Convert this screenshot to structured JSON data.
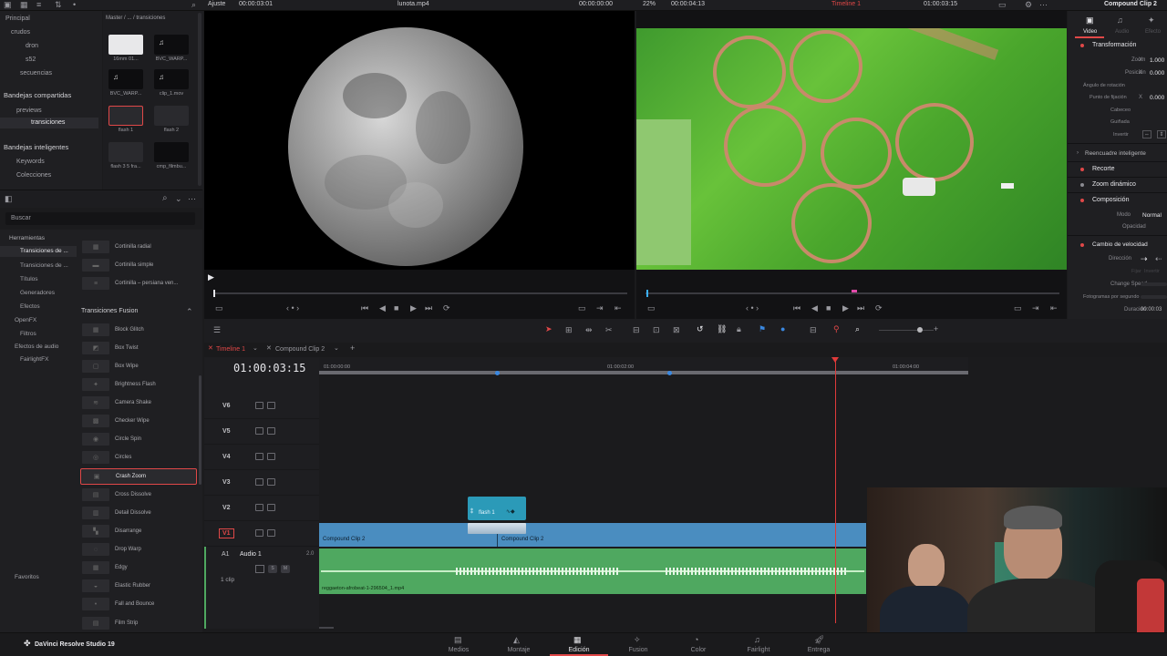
{
  "top_bar": {
    "zoom_label": "Ajuste",
    "left_timecode": "00:00:03:01",
    "left_clip_name": "lunota.mp4",
    "left_duration": "00:00:00:00",
    "right_zoom": "22%",
    "right_duration": "00:00:04:13",
    "timeline_name": "Timeline 1",
    "right_timecode": "01:00:03:15",
    "inspector_title": "Compound Clip 2"
  },
  "media_pool": {
    "breadcrumb": "Master / ... / transiciones",
    "tree": [
      {
        "label": "Principal"
      },
      {
        "label": "crudos"
      },
      {
        "label": "dron"
      },
      {
        "label": "s52"
      },
      {
        "label": "secuencias"
      }
    ],
    "shared_header": "Bandejas compartidas",
    "shared_items": [
      {
        "label": "previews"
      },
      {
        "label": "transiciones"
      }
    ],
    "smart_header": "Bandejas inteligentes",
    "smart_items": [
      {
        "label": "Keywords"
      },
      {
        "label": "Colecciones"
      }
    ],
    "clips": [
      {
        "label": "16mm 01..."
      },
      {
        "label": "BVC_WARP..."
      },
      {
        "label": "BVC_WARP..."
      },
      {
        "label": "clip_1.mov"
      },
      {
        "label": "flash 1"
      },
      {
        "label": "flash 2"
      },
      {
        "label": "flash 3 5 fra..."
      },
      {
        "label": "cmp_filmbu..."
      }
    ]
  },
  "effects": {
    "search_label": "Buscar",
    "tree": [
      {
        "label": "Herramientas"
      },
      {
        "label": "Transiciones de ..."
      },
      {
        "label": "Transiciones de ..."
      },
      {
        "label": "Títulos"
      },
      {
        "label": "Generadores"
      },
      {
        "label": "Efectos"
      },
      {
        "label": "OpenFX"
      },
      {
        "label": "Filtros"
      },
      {
        "label": "Efectos de audio"
      },
      {
        "label": "FairlightFX"
      }
    ],
    "favorites_label": "Favoritos",
    "top_items": [
      {
        "label": "Cortinilla radial"
      },
      {
        "label": "Cortinilla simple"
      },
      {
        "label": "Cortinilla – persiana ven..."
      }
    ],
    "fusion_header": "Transiciones Fusion",
    "fusion_items": [
      {
        "label": "Block Glitch"
      },
      {
        "label": "Box Twist"
      },
      {
        "label": "Box Wipe"
      },
      {
        "label": "Brightness Flash"
      },
      {
        "label": "Camera Shake"
      },
      {
        "label": "Checker Wipe"
      },
      {
        "label": "Circle Spin"
      },
      {
        "label": "Circles"
      },
      {
        "label": "Crash Zoom"
      },
      {
        "label": "Cross Dissolve"
      },
      {
        "label": "Detail Dissolve"
      },
      {
        "label": "Disarrange"
      },
      {
        "label": "Drop Warp"
      },
      {
        "label": "Edgy"
      },
      {
        "label": "Elastic Rubber"
      },
      {
        "label": "Fall and Bounce"
      },
      {
        "label": "Film Strip"
      }
    ],
    "selected_item": "Crash Zoom"
  },
  "inspector": {
    "tabs": [
      {
        "label": "Video"
      },
      {
        "label": "Audio"
      },
      {
        "label": "Efecto"
      }
    ],
    "sections": {
      "transform": "Transformación",
      "zoom": "Zoom",
      "zoom_x": "1.000",
      "position": "Posición",
      "position_x": "0.000",
      "rotation": "Ángulo de rotación",
      "anchor": "Punto de fijación",
      "anchor_x": "0.000",
      "pitch": "Cabeceo",
      "yaw": "Guiñada",
      "flip": "Invertir",
      "smart_reframe": "Reencuadre inteligente",
      "crop": "Recorte",
      "dynamic_zoom": "Zoom dinámico",
      "composite": "Composición",
      "mode": "Modo",
      "mode_value": "Normal",
      "opacity": "Opacidad",
      "speed_change": "Cambio de velocidad",
      "direction": "Dirección",
      "freeze": "Fijar",
      "reverse": "Invertir",
      "change_speed": "Change Speed",
      "fps": "Fotogramas por segundo",
      "duration": "Duración",
      "duration_value": "00:00:03"
    },
    "x_label": "X"
  },
  "timeline": {
    "tabs": [
      {
        "label": "Timeline 1"
      },
      {
        "label": "Compound Clip 2"
      }
    ],
    "current_timecode": "01:00:03:15",
    "ruler": [
      "01:00:00:00",
      "01:00:02:00",
      "01:00:04:00"
    ],
    "tracks": [
      {
        "label": "V6"
      },
      {
        "label": "V5"
      },
      {
        "label": "V4"
      },
      {
        "label": "V3"
      },
      {
        "label": "V2"
      },
      {
        "label": "V1"
      }
    ],
    "audio_track": {
      "label": "A1",
      "name": "Audio 1",
      "level": "2.0",
      "clips_count": "1 clip"
    },
    "clips": {
      "flash": "flash 1",
      "compound_a": "Compound Clip 2",
      "compound_b": "Compound Clip 2",
      "audio": "reggaeton-afrobeat-1-296504_1.mp4"
    }
  },
  "pages": [
    {
      "label": "Medios"
    },
    {
      "label": "Montaje"
    },
    {
      "label": "Edición"
    },
    {
      "label": "Fusion"
    },
    {
      "label": "Color"
    },
    {
      "label": "Fairlight"
    },
    {
      "label": "Entrega"
    }
  ],
  "active_page": "Edición",
  "app_name": "DaVinci Resolve Studio 19",
  "colors": {
    "accent_red": "#e04848",
    "video_clip": "#4a8dc0",
    "audio_clip": "#4fa860",
    "flash_clip": "#2b9ab8",
    "playhead": "#e03a3a"
  }
}
